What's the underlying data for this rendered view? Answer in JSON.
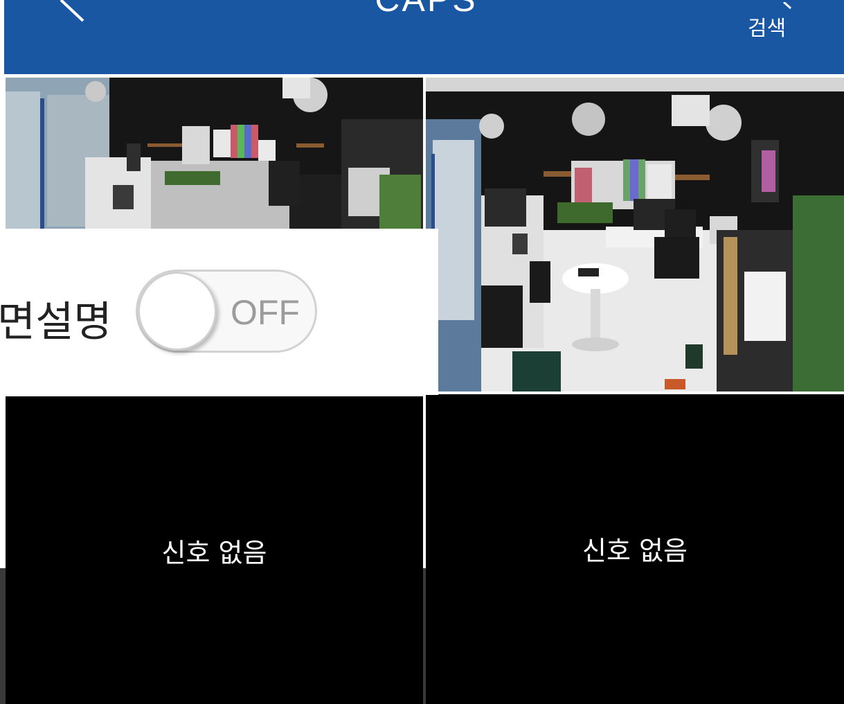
{
  "header": {
    "title": "CAPS",
    "search_label": "검색",
    "background": "#1a57a3",
    "back_icon": "chevron-left-icon",
    "search_icon": "magnifier-icon"
  },
  "cameras": [
    {
      "status": "live"
    },
    {
      "status": "live"
    },
    {
      "status": "no-signal",
      "message": "신호 없음"
    },
    {
      "status": "no-signal",
      "message": "신호 없음"
    }
  ],
  "overlay": {
    "label": "면설명",
    "toggle_text": "OFF",
    "toggle_on": false
  }
}
